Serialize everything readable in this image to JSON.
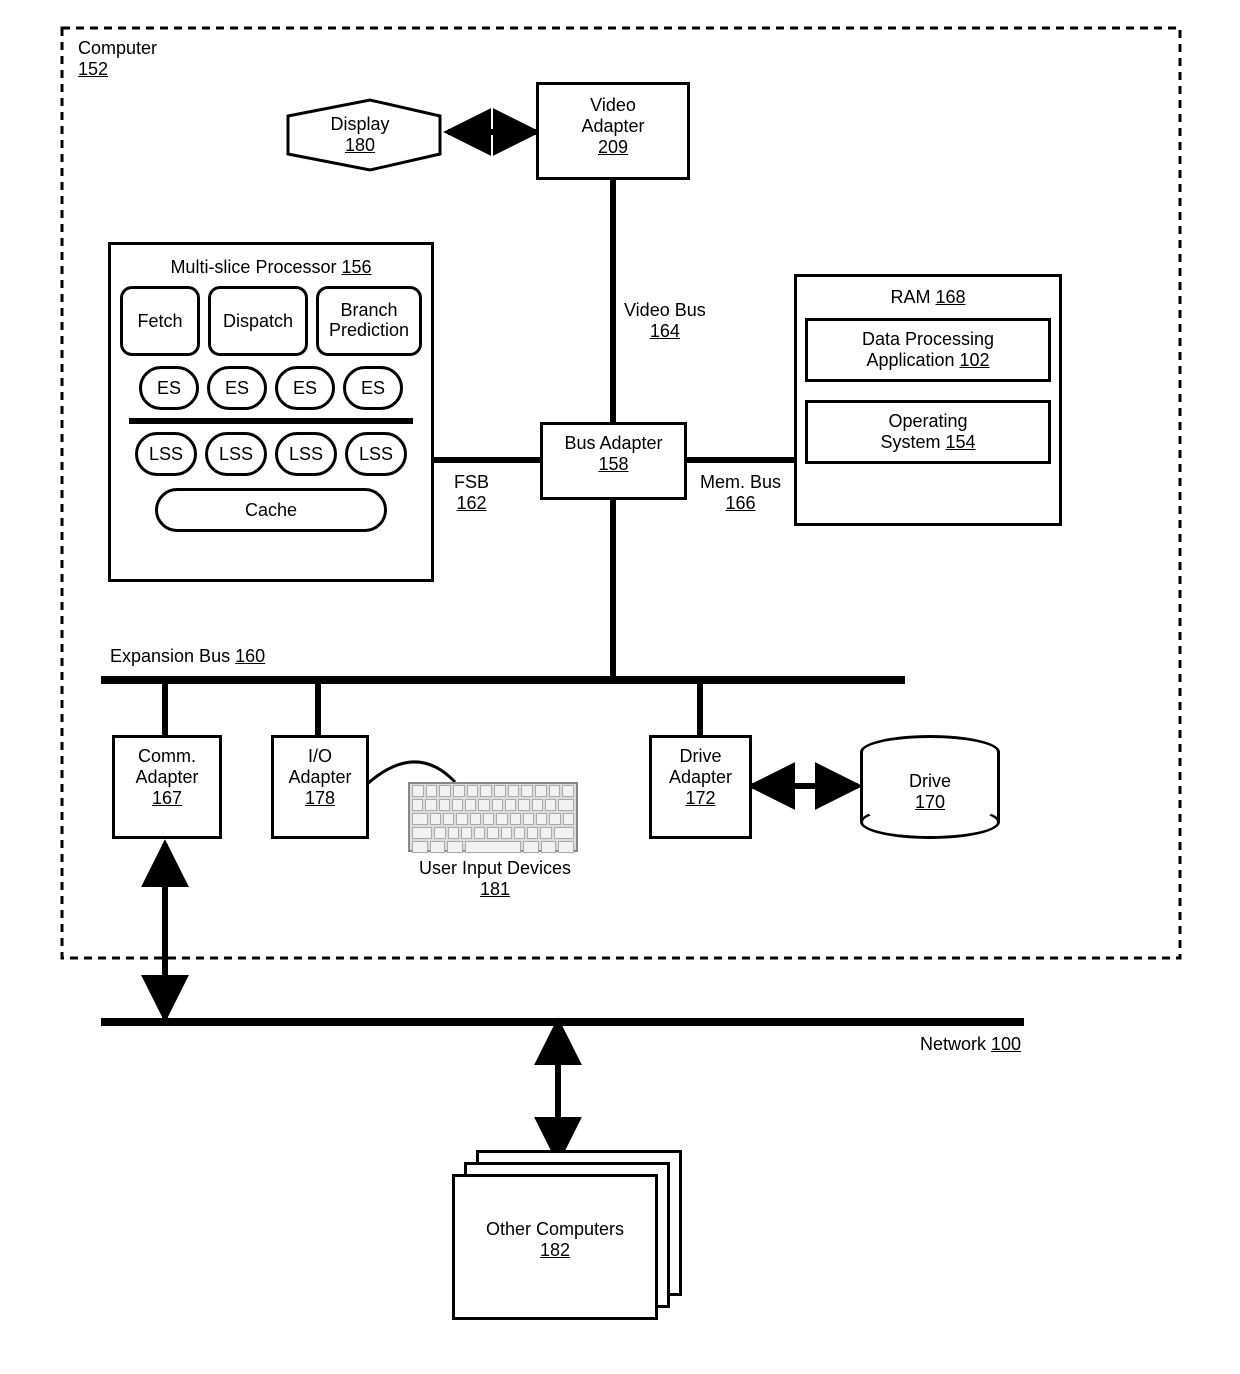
{
  "computer": {
    "label": "Computer",
    "ref": "152"
  },
  "display": {
    "label": "Display",
    "ref": "180"
  },
  "video_adapter": {
    "label": "Video Adapter",
    "ref": "209"
  },
  "msp": {
    "title": "Multi-slice Processor",
    "ref": "156",
    "fetch": "Fetch",
    "dispatch": "Dispatch",
    "bp": "Branch Prediction",
    "es": "ES",
    "lss": "LSS",
    "cache": "Cache"
  },
  "bus_adapter": {
    "label": "Bus Adapter",
    "ref": "158"
  },
  "video_bus": {
    "label": "Video Bus",
    "ref": "164"
  },
  "fsb": {
    "label": "FSB",
    "ref": "162"
  },
  "mem_bus": {
    "label": "Mem. Bus",
    "ref": "166"
  },
  "ram": {
    "label": "RAM",
    "ref": "168"
  },
  "dpa": {
    "label": "Data Processing Application",
    "ref": "102"
  },
  "os": {
    "label": "Operating System",
    "ref": "154"
  },
  "exp_bus": {
    "label": "Expansion Bus",
    "ref": "160"
  },
  "comm_adapter": {
    "label": "Comm. Adapter",
    "ref": "167"
  },
  "io_adapter": {
    "label": "I/O Adapter",
    "ref": "178"
  },
  "uid": {
    "label": "User Input Devices",
    "ref": "181"
  },
  "drive_adapter": {
    "label": "Drive Adapter",
    "ref": "172"
  },
  "drive": {
    "label": "Drive",
    "ref": "170"
  },
  "network": {
    "label": "Network",
    "ref": "100"
  },
  "other_comp": {
    "label": "Other Computers",
    "ref": "182"
  }
}
